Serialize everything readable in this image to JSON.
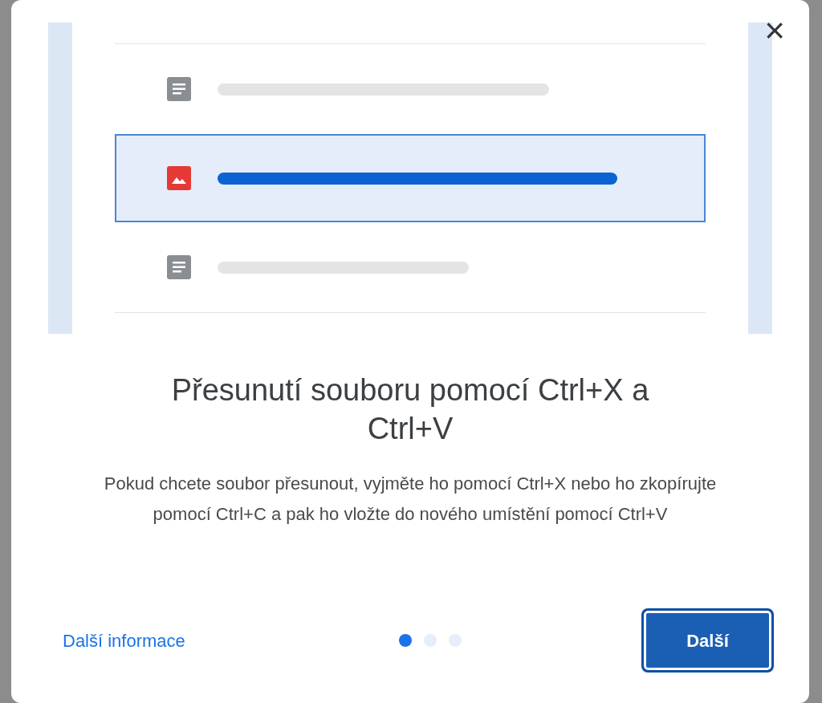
{
  "dialog": {
    "close": "×",
    "illustration": {
      "rows": [
        {
          "kind": "document",
          "selected": false
        },
        {
          "kind": "image",
          "selected": true
        },
        {
          "kind": "document",
          "selected": false
        }
      ]
    },
    "title": "Přesunutí souboru pomocí Ctrl+X a Ctrl+V",
    "body": "Pokud chcete soubor přesunout, vyjměte ho pomocí Ctrl+X nebo ho zkopírujte pomocí Ctrl+C a pak ho vložte do nového umístění pomocí Ctrl+V",
    "link": "Další informace",
    "pages": [
      {
        "selected": true
      },
      {
        "selected": false
      },
      {
        "selected": false
      }
    ],
    "button": "Další"
  }
}
